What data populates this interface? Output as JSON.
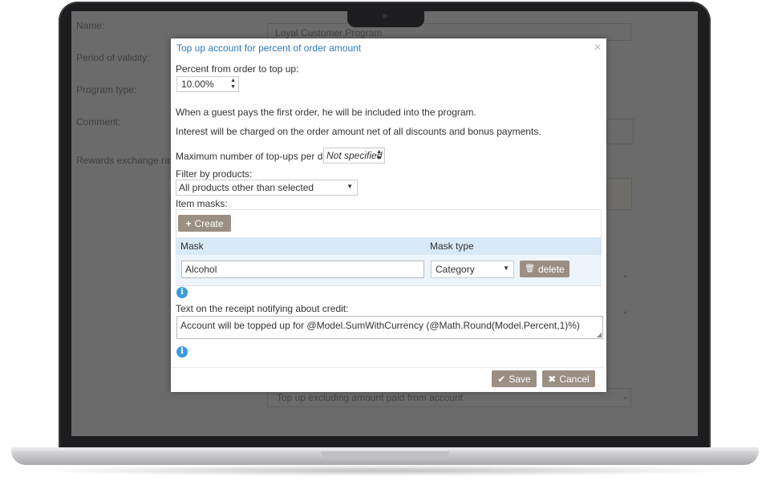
{
  "background": {
    "labels": {
      "name": "Name:",
      "period": "Period of validity:",
      "program_type": "Program type:",
      "comment": "Comment:",
      "rewards": "Rewards exchange rate"
    },
    "name_value": "Loyal Customer Program",
    "bottom_select": "Top up excluding amount paid from account"
  },
  "modal": {
    "title": "Top up account for percent of order amount",
    "close_icon": "close-icon",
    "percent_label": "Percent from order to top up:",
    "percent_value": "10.00%",
    "info_line_1": "When a guest pays the first order, he will be included into the program.",
    "info_line_2": "Interest will be charged on the order amount net of all discounts and bonus payments.",
    "max_topups_label": "Maximum number of top-ups per day",
    "max_topups_value": "Not specified",
    "filter_label": "Filter by products:",
    "filter_value": "All products other than selected",
    "item_masks_label": "Item masks:",
    "create_button": "Create",
    "table": {
      "columns": [
        "Mask",
        "Mask type"
      ],
      "rows": [
        {
          "mask": "Alcohol",
          "mask_type": "Category",
          "delete_label": "delete"
        }
      ]
    },
    "receipt_label": "Text on the receipt notifying about credit:",
    "receipt_text": "Account will be topped up for @Model.SumWithCurrency (@Math.Round(Model.Percent,1)%)",
    "save_button": "Save",
    "cancel_button": "Cancel",
    "colors": {
      "title": "#2a7bbf",
      "button": "#9b8e83",
      "table_header": "#d9e9f7",
      "table_row": "#edf4fb",
      "info_icon": "#3b9bd9"
    }
  }
}
